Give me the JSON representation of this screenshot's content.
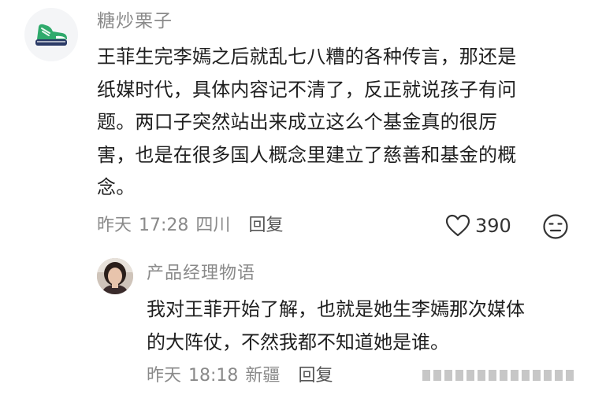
{
  "comment": {
    "username": "糖炒栗子",
    "avatar_icon": "sneaker-icon",
    "body_lines": [
      "王菲生完李嫣之后就乱七八糟的各种传言，那还是",
      "纸媒时代，具体内容记不清了，反正就说孩子有问",
      "题。两口子突然站出来成立这么个基金真的很厉",
      "害，也是在很多国人概念里建立了慈善和基金的概",
      "念。"
    ],
    "date": "昨天",
    "time": "17:28",
    "location": "四川",
    "reply_label": "回复",
    "like_icon": "heart-outline-icon",
    "like_count": "390",
    "dislike_icon": "meh-face-icon"
  },
  "reply": {
    "username": "产品经理物语",
    "avatar_icon": "user-photo-avatar",
    "body_lines": [
      "我对王菲开始了解，也就是她生李嫣那次媒体",
      "的大阵仗，不然我都不知道她是谁。"
    ],
    "date": "昨天",
    "time": "18:18",
    "location": "新疆",
    "reply_label": "回复"
  },
  "colors": {
    "text_primary": "#1f1f1f",
    "text_secondary": "#8a8a8a",
    "sneaker_green": "#2faa6c",
    "sneaker_navy": "#2b3a66"
  }
}
